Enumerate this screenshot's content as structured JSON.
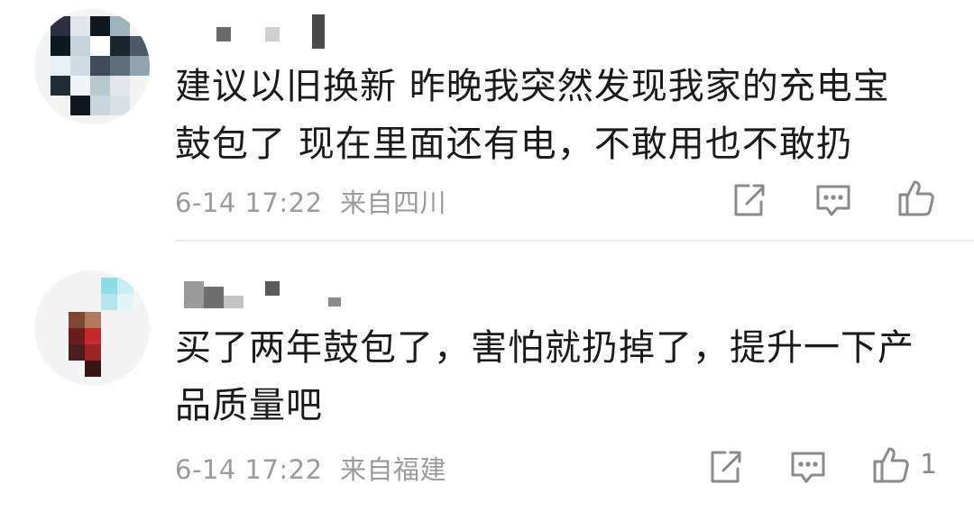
{
  "comments": [
    {
      "text": "建议以旧换新 昨晚我突然发现我家的充电宝\n鼓包了 现在里面还有电，不敢用也不敢扔",
      "timestamp": "6-14 17:22",
      "location": "来自四川",
      "like_count": ""
    },
    {
      "text": "买了两年鼓包了，害怕就扔掉了，提升一下产\n品质量吧",
      "timestamp": "6-14 17:22",
      "location": "来自福建",
      "like_count": "1"
    }
  ],
  "colors": {
    "text": "#1a1a1a",
    "meta": "#9b9b9b",
    "icon": "#8a8a8a",
    "divider": "#ececec"
  },
  "icons": [
    "share-icon",
    "reply-icon",
    "like-icon"
  ]
}
